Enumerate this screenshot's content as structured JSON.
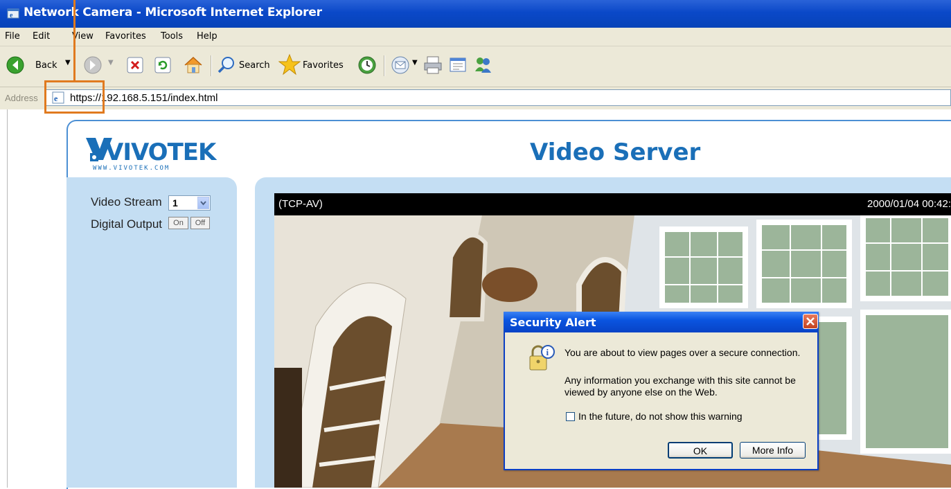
{
  "window": {
    "title": "Network Camera - Microsoft Internet Explorer"
  },
  "menu": [
    "File",
    "Edit",
    "View",
    "Favorites",
    "Tools",
    "Help"
  ],
  "toolbar": {
    "back": "Back",
    "search": "Search",
    "favorites": "Favorites"
  },
  "address": {
    "label": "Address",
    "url": "https://192.168.5.151/index.html"
  },
  "page": {
    "logo_brand": "VIVOTEK",
    "logo_url": "WWW.VIVOTEK.COM",
    "heading": "Video Server",
    "video_stream_label": "Video Stream",
    "video_stream_value": "1",
    "digital_output_label": "Digital Output",
    "on_label": "On",
    "off_label": "Off",
    "video_protocol": "(TCP-AV)",
    "video_timestamp": "2000/01/04 00:42:"
  },
  "dialog": {
    "title": "Security Alert",
    "line1": "You are about to view pages over a secure connection.",
    "line2a": "Any information you exchange with this site cannot be",
    "line2b": "viewed by anyone else on the Web.",
    "checkbox_label": "In the future, do not show this warning",
    "ok_label": "OK",
    "more_info_label": "More Info"
  },
  "colors": {
    "annotation": "#e07a1f",
    "heading": "#1a6fb8",
    "panel": "#c4def3"
  }
}
